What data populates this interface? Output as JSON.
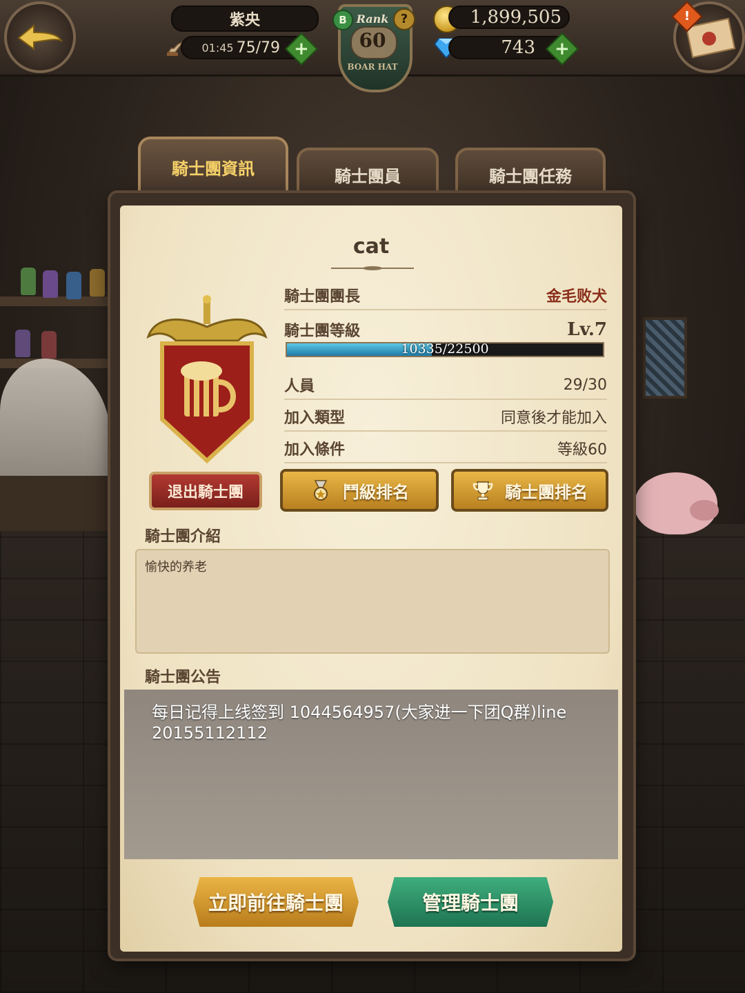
{
  "header": {
    "player_name": "紫央",
    "stamina_timer": "01:45",
    "stamina": "75/79",
    "rank_label": "Rank",
    "rank_value": "60",
    "rank_sub": "BOAR HAT",
    "b_badge": "B",
    "help_badge": "?",
    "gold": "1,899,505",
    "gems": "743",
    "plus_symbol": "+",
    "alert_symbol": "!"
  },
  "tabs": [
    {
      "label": "騎士團資訊",
      "active": true
    },
    {
      "label": "騎士團員",
      "active": false
    },
    {
      "label": "騎士團任務",
      "active": false
    }
  ],
  "guild": {
    "name": "cat",
    "leader_label": "騎士團團長",
    "leader_value": "金毛败犬",
    "level_label": "騎士團等級",
    "level_value": "Lv.7",
    "exp_text": "10335/22500",
    "exp_fraction": 0.4593,
    "members_label": "人員",
    "members_value": "29/30",
    "jointype_label": "加入類型",
    "jointype_value": "同意後才能加入",
    "condition_label": "加入條件",
    "condition_value": "等級60"
  },
  "buttons": {
    "leave": "退出騎士團",
    "battle_rank": "鬥級排名",
    "guild_rank": "騎士團排名",
    "goto": "立即前往騎士團",
    "manage": "管理騎士團"
  },
  "intro": {
    "title": "騎士團介紹",
    "text": "愉快的养老"
  },
  "notice": {
    "title": "騎士團公告",
    "text": "每日记得上线签到 1044564957(大家进一下团Q群)line 20155112112"
  },
  "colors": {
    "accent_gold": "#f6d168",
    "leave_red": "#b23a32",
    "manage_green": "#3fae7d",
    "exp_blue": "#1f7aa6"
  },
  "icons": {
    "back": "back-arrow-icon",
    "stamina": "wing-boot-icon",
    "gold": "gold-coin-icon",
    "gem": "diamond-icon",
    "mail": "mail-icon",
    "battle_rank": "medal-icon",
    "guild_rank": "trophy-icon",
    "emblem": "beer-mug-banner-icon"
  }
}
